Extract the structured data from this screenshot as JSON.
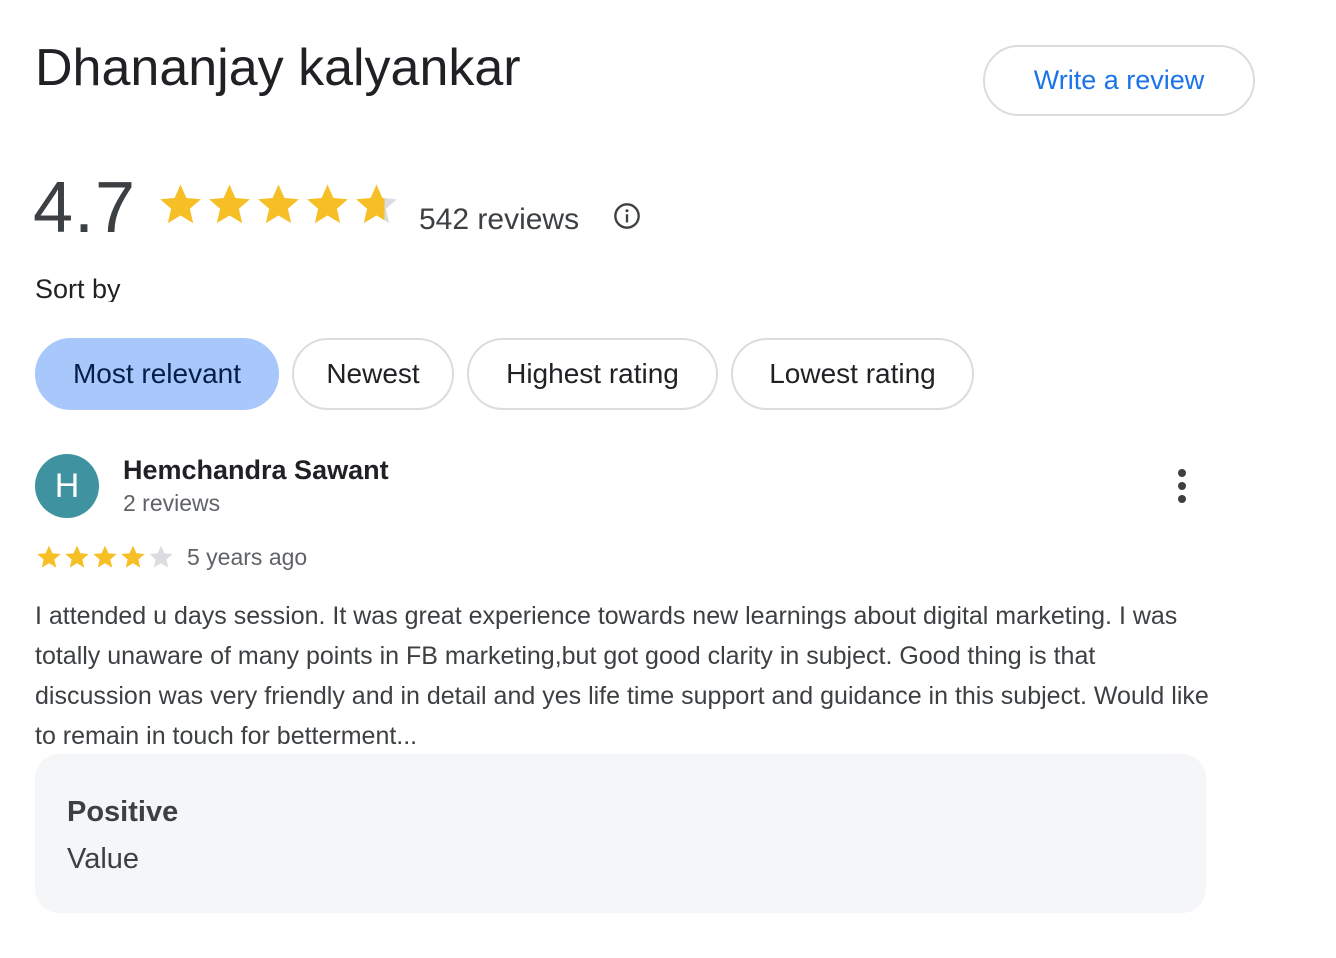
{
  "business": {
    "name": "Dhananjay kalyankar",
    "write_review_label": "Write a review",
    "rating": "4.7",
    "rating_value": 4.7,
    "reviews_count": "542 reviews"
  },
  "sort": {
    "label": "Sort by",
    "options": [
      {
        "label": "Most relevant",
        "active": true
      },
      {
        "label": "Newest",
        "active": false
      },
      {
        "label": "Highest rating",
        "active": false
      },
      {
        "label": "Lowest rating",
        "active": false
      }
    ]
  },
  "review": {
    "avatar_initial": "H",
    "avatar_color": "#3f93a1",
    "reviewer_name": "Hemchandra Sawant",
    "reviewer_meta": "2 reviews",
    "stars": 4,
    "time": "5 years ago",
    "text": "I attended u days session. It was great experience towards new learnings about digital marketing. I was totally unaware of many points in FB marketing,but got good clarity in subject. Good thing is that discussion was very friendly and in detail and yes life time support and guidance in this subject. Would like to remain in touch for betterment...",
    "attribute_title": "Positive",
    "attribute_value": "Value"
  },
  "colors": {
    "star_filled": "#f6bf26",
    "star_empty": "#dadce0",
    "accent": "#1a73e8",
    "chip_active": "#a8c7fa"
  }
}
